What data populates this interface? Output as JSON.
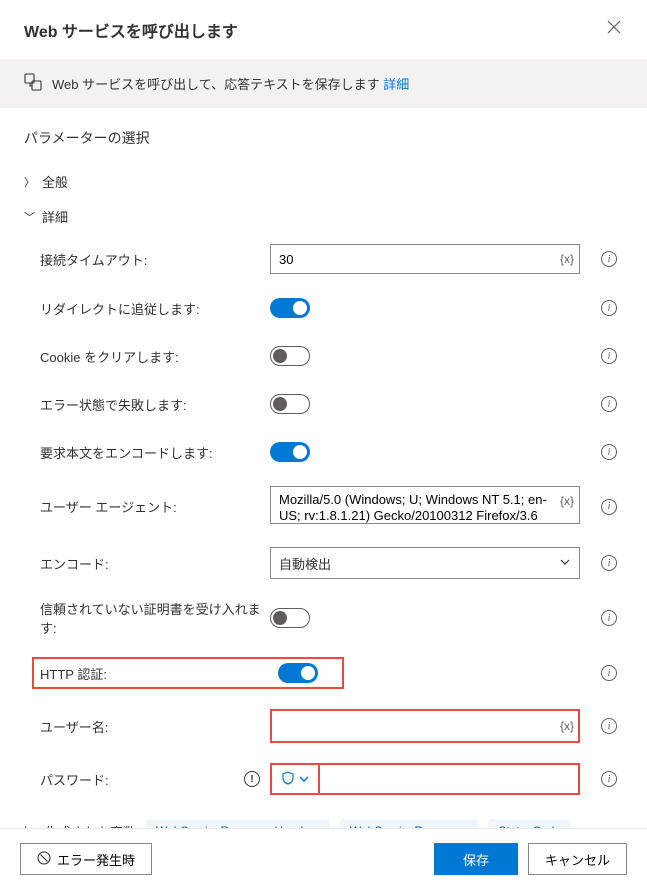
{
  "header": {
    "title": "Web サービスを呼び出します"
  },
  "banner": {
    "text": "Web サービスを呼び出して、応答テキストを保存します ",
    "link": "詳細"
  },
  "params": {
    "title": "パラメーターの選択",
    "general_label": "全般",
    "advanced_label": "詳細"
  },
  "advanced": {
    "timeout": {
      "label": "接続タイムアウト:",
      "value": "30"
    },
    "follow_redirect": {
      "label": "リダイレクトに追従します:",
      "on": true
    },
    "clear_cookies": {
      "label": "Cookie をクリアします:",
      "on": false
    },
    "fail_on_error": {
      "label": "エラー状態で失敗します:",
      "on": false
    },
    "encode_body": {
      "label": "要求本文をエンコードします:",
      "on": true
    },
    "user_agent": {
      "label": "ユーザー エージェント:",
      "value": "Mozilla/5.0 (Windows; U; Windows NT 5.1; en-US; rv:1.8.1.21) Gecko/20100312 Firefox/3.6"
    },
    "encoding": {
      "label": "エンコード:",
      "value": "自動検出"
    },
    "accept_untrusted": {
      "label": "信頼されていない証明書を受け入れます:",
      "on": false
    },
    "http_auth": {
      "label": "HTTP 認証:",
      "on": true
    },
    "username": {
      "label": "ユーザー名:",
      "value": ""
    },
    "password": {
      "label": "パスワード:",
      "value": ""
    }
  },
  "generated": {
    "label": "生成された変数",
    "vars": [
      "WebServiceResponseHeaders",
      "WebServiceResponse",
      "StatusCode"
    ]
  },
  "footer": {
    "on_error": "エラー発生時",
    "save": "保存",
    "cancel": "キャンセル"
  },
  "var_placeholder": "{x}"
}
